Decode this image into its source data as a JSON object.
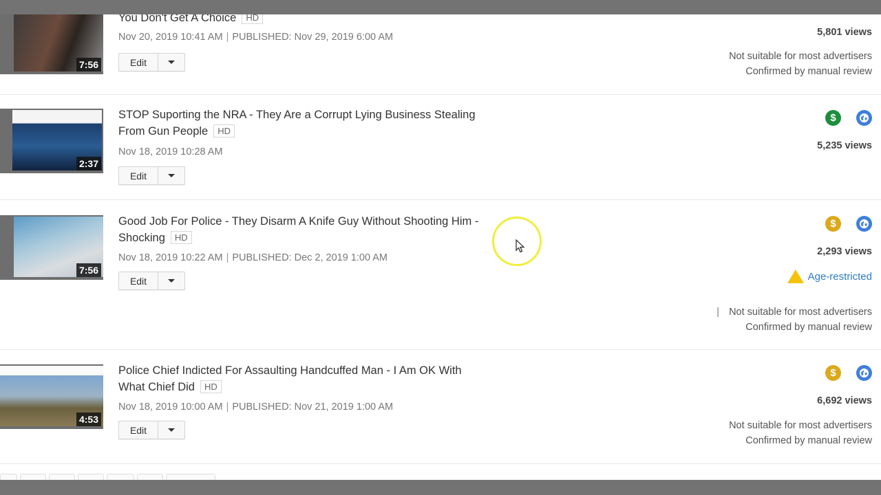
{
  "colors": {
    "monetization_green": "#1e8e3e",
    "monetization_gold": "#dba91b",
    "visibility_blue": "#3f7fdc",
    "age_warning": "#f4c20d",
    "age_link": "#2f7bc4"
  },
  "videos": [
    {
      "title": "You Don't Get A Choice",
      "badge": "HD",
      "duration": "7:56",
      "uploaded": "Nov 20, 2019 10:41 AM",
      "published": "PUBLISHED: Nov 29, 2019 6:00 AM",
      "edit_label": "Edit",
      "views": "5,801 views",
      "ad_status_line1": "Not suitable for most advertisers",
      "ad_status_line2": "Confirmed by manual review"
    },
    {
      "title": "STOP Suporting the NRA - They Are a Corrupt Lying Business Stealing From Gun People",
      "badge": "HD",
      "duration": "2:37",
      "uploaded": "Nov 18, 2019 10:28 AM",
      "edit_label": "Edit",
      "monetization_icon": "dollar-green-icon",
      "visibility_icon": "globe-public-icon",
      "views": "5,235 views"
    },
    {
      "title": "Good Job For Police - They Disarm A Knife Guy Without Shooting Him - Shocking",
      "badge": "HD",
      "duration": "7:56",
      "uploaded": "Nov 18, 2019 10:22 AM",
      "published": "PUBLISHED: Dec 2, 2019 1:00 AM",
      "edit_label": "Edit",
      "monetization_icon": "dollar-gold-icon",
      "visibility_icon": "globe-public-icon",
      "views": "2,293 views",
      "restriction": "Age-restricted",
      "pipe": "|",
      "ad_status_line1": "Not suitable for most advertisers",
      "ad_status_line2": "Confirmed by manual review"
    },
    {
      "title": "Police Chief Indicted For Assaulting Handcuffed Man - I Am OK With What Chief Did",
      "badge": "HD",
      "duration": "4:53",
      "uploaded": "Nov 18, 2019 10:00 AM",
      "published": "PUBLISHED: Nov 21, 2019 1:00 AM",
      "edit_label": "Edit",
      "monetization_icon": "dollar-gold-icon",
      "visibility_icon": "globe-public-icon",
      "views": "6,692 views",
      "ad_status_line1": "Not suitable for most advertisers",
      "ad_status_line2": "Confirmed by manual review"
    }
  ],
  "icons": {
    "dollar": "$",
    "separator": "|"
  }
}
